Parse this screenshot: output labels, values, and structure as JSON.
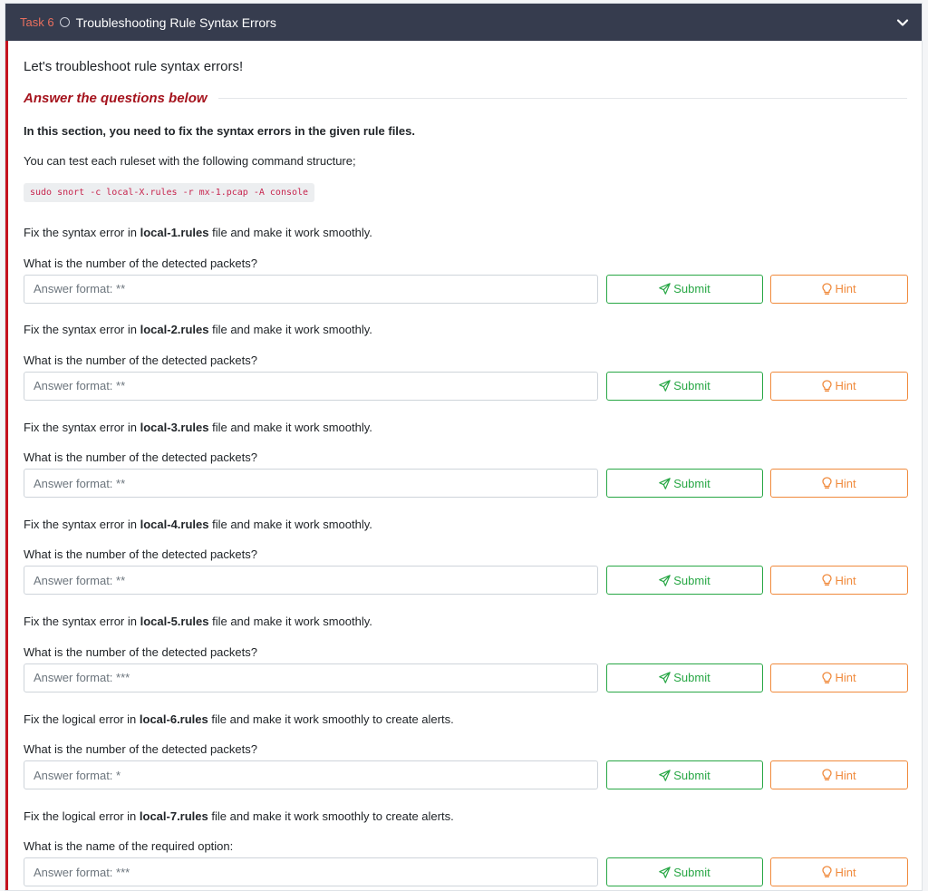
{
  "task": {
    "label": "Task 6",
    "title": "Troubleshooting Rule Syntax Errors"
  },
  "intro": "Let's troubleshoot rule syntax errors!",
  "answer_heading": "Answer the questions below",
  "section_note": "In this section, you need to fix the syntax errors in the given rule files.",
  "command_note": "You can test each ruleset with the following command structure;",
  "command": "sudo snort -c local-X.rules -r mx-1.pcap -A console",
  "labels": {
    "submit": "Submit",
    "hint": "Hint"
  },
  "questions": [
    {
      "pre": "Fix the syntax error in ",
      "file": "local-1.rules",
      "post": " file and make it work smoothly.",
      "question": "What is the number of the detected packets?",
      "placeholder": "Answer format: **"
    },
    {
      "pre": "Fix the syntax error in ",
      "file": "local-2.rules",
      "post": " file and make it work smoothly.",
      "question": "What is the number of the detected packets?",
      "placeholder": "Answer format: **"
    },
    {
      "pre": "Fix the syntax error in ",
      "file": "local-3.rules",
      "post": " file and make it work smoothly.",
      "question": "What is the number of the detected packets?",
      "placeholder": "Answer format: **"
    },
    {
      "pre": "Fix the syntax error in ",
      "file": "local-4.rules",
      "post": " file and make it work smoothly.",
      "question": "What is the number of the detected packets?",
      "placeholder": "Answer format: **"
    },
    {
      "pre": "Fix the syntax error in ",
      "file": "local-5.rules",
      "post": " file and make it work smoothly.",
      "question": "What is the number of the detected packets?",
      "placeholder": "Answer format: ***"
    },
    {
      "pre": "Fix the logical error in ",
      "file": "local-6.rules",
      "post": " file and make it work smoothly to create alerts.",
      "question": "What is the number of the detected packets?",
      "placeholder": "Answer format: *"
    },
    {
      "pre": "Fix the logical error in ",
      "file": "local-7.rules",
      "post": " file and make it work smoothly to create alerts.",
      "question": "What is the name of the required option:",
      "placeholder": "Answer format: ***"
    }
  ]
}
